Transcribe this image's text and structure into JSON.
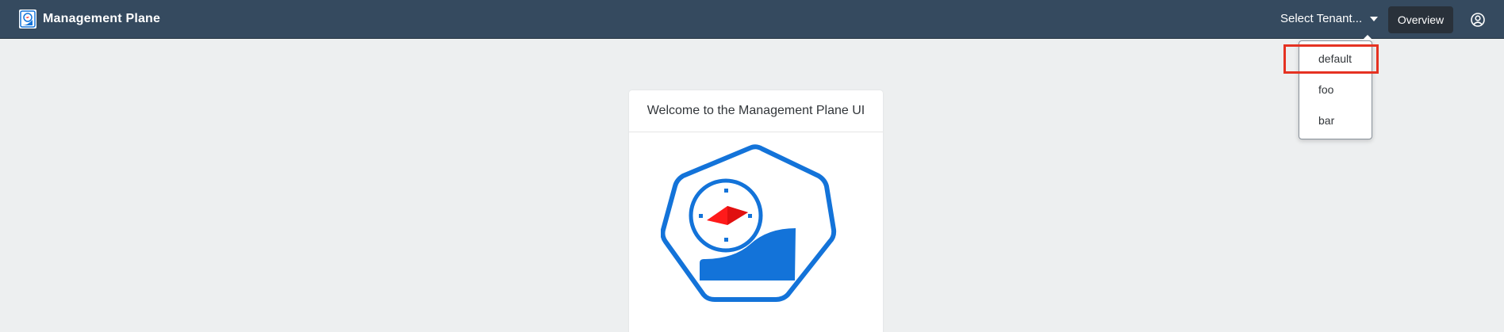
{
  "app": {
    "title": "Management Plane",
    "logo_icon": "management-plane-logo-icon"
  },
  "header": {
    "tenant_select_label": "Select Tenant...",
    "overview_label": "Overview",
    "user_icon": "user-circle-icon"
  },
  "tenant_menu": {
    "items": [
      {
        "label": "default",
        "highlighted": true
      },
      {
        "label": "foo",
        "highlighted": false
      },
      {
        "label": "bar",
        "highlighted": false
      }
    ]
  },
  "welcome_card": {
    "title": "Welcome to the Management Plane UI",
    "image_icon": "heptagon-compass-logo-icon"
  },
  "colors": {
    "shell_bar": "#354a5f",
    "overview_button": "#29313a",
    "content_background": "#edeff0",
    "logo_blue": "#1373d9",
    "needle_red": "#ff1a1a",
    "highlight_red": "#e53222"
  }
}
